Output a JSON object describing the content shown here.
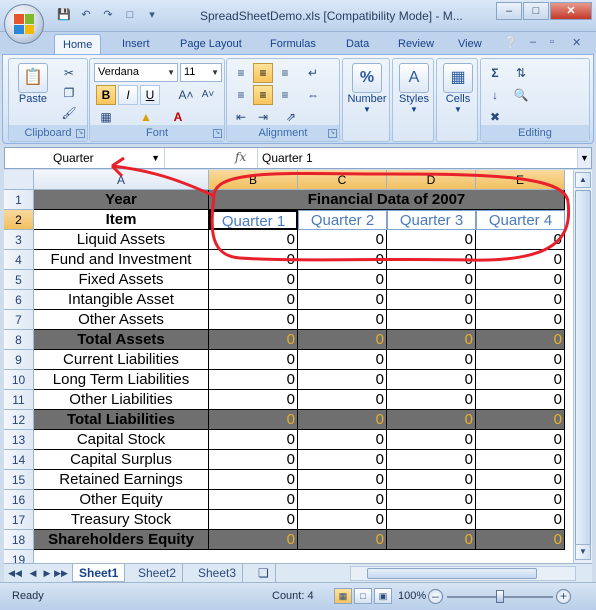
{
  "window": {
    "title": "SpreadSheetDemo.xls [Compatibility Mode] - M...",
    "minimize": "–",
    "maximize": "□",
    "close": "✕"
  },
  "qat": {
    "save_icon": "save-icon",
    "undo_icon": "undo-icon",
    "redo_icon": "redo-icon",
    "new_icon": "new-document-icon"
  },
  "tabs": [
    "Home",
    "Insert",
    "Page Layout",
    "Formulas",
    "Data",
    "Review",
    "View"
  ],
  "ribbon": {
    "clipboard": {
      "label": "Clipboard",
      "paste": "Paste"
    },
    "font": {
      "label": "Font",
      "family": "Verdana",
      "size": "11"
    },
    "alignment": {
      "label": "Alignment"
    },
    "number": {
      "label": "Number"
    },
    "styles": {
      "label": "Styles"
    },
    "cells": {
      "label": "Cells"
    },
    "editing": {
      "label": "Editing"
    }
  },
  "formula_bar": {
    "name_box": "Quarter",
    "fx": "fx",
    "value": "Quarter 1"
  },
  "grid": {
    "columns": [
      "A",
      "B",
      "C",
      "D",
      "E"
    ],
    "rows": [
      "1",
      "2",
      "3",
      "4",
      "5",
      "6",
      "7",
      "8",
      "9",
      "10",
      "11",
      "12",
      "13",
      "14",
      "15",
      "16",
      "17",
      "18",
      "19"
    ],
    "year_label": "Year",
    "item_label": "Item",
    "banner": "Financial Data of 2007",
    "quarters": [
      "Quarter 1",
      "Quarter 2",
      "Quarter 3",
      "Quarter 4"
    ],
    "items": [
      {
        "label": "Liquid Assets",
        "total": false,
        "values": [
          "0",
          "0",
          "0",
          "0"
        ]
      },
      {
        "label": "Fund and Investment",
        "total": false,
        "values": [
          "0",
          "0",
          "0",
          "0"
        ]
      },
      {
        "label": "Fixed Assets",
        "total": false,
        "values": [
          "0",
          "0",
          "0",
          "0"
        ]
      },
      {
        "label": "Intangible Asset",
        "total": false,
        "values": [
          "0",
          "0",
          "0",
          "0"
        ]
      },
      {
        "label": "Other Assets",
        "total": false,
        "values": [
          "0",
          "0",
          "0",
          "0"
        ]
      },
      {
        "label": "Total Assets",
        "total": true,
        "values": [
          "0",
          "0",
          "0",
          "0"
        ]
      },
      {
        "label": "Current Liabilities",
        "total": false,
        "values": [
          "0",
          "0",
          "0",
          "0"
        ]
      },
      {
        "label": "Long Term Liabilities",
        "total": false,
        "values": [
          "0",
          "0",
          "0",
          "0"
        ]
      },
      {
        "label": "Other Liabilities",
        "total": false,
        "values": [
          "0",
          "0",
          "0",
          "0"
        ]
      },
      {
        "label": "Total Liabilities",
        "total": true,
        "values": [
          "0",
          "0",
          "0",
          "0"
        ]
      },
      {
        "label": "Capital Stock",
        "total": false,
        "values": [
          "0",
          "0",
          "0",
          "0"
        ]
      },
      {
        "label": "Capital Surplus",
        "total": false,
        "values": [
          "0",
          "0",
          "0",
          "0"
        ]
      },
      {
        "label": "Retained Earnings",
        "total": false,
        "values": [
          "0",
          "0",
          "0",
          "0"
        ]
      },
      {
        "label": "Other Equity",
        "total": false,
        "values": [
          "0",
          "0",
          "0",
          "0"
        ]
      },
      {
        "label": "Treasury Stock",
        "total": false,
        "values": [
          "0",
          "0",
          "0",
          "0"
        ]
      },
      {
        "label": "Shareholders Equity",
        "total": true,
        "values": [
          "0",
          "0",
          "0",
          "0"
        ]
      }
    ]
  },
  "sheets": [
    "Sheet1",
    "Sheet2",
    "Sheet3"
  ],
  "status": {
    "ready": "Ready",
    "count": "Count: 4",
    "zoom": "100%",
    "zoom_level": 1.0
  },
  "colors": {
    "annotation": "#e8202a",
    "total_value": "#e6b12a",
    "quarter_text": "#4a7bbf"
  }
}
